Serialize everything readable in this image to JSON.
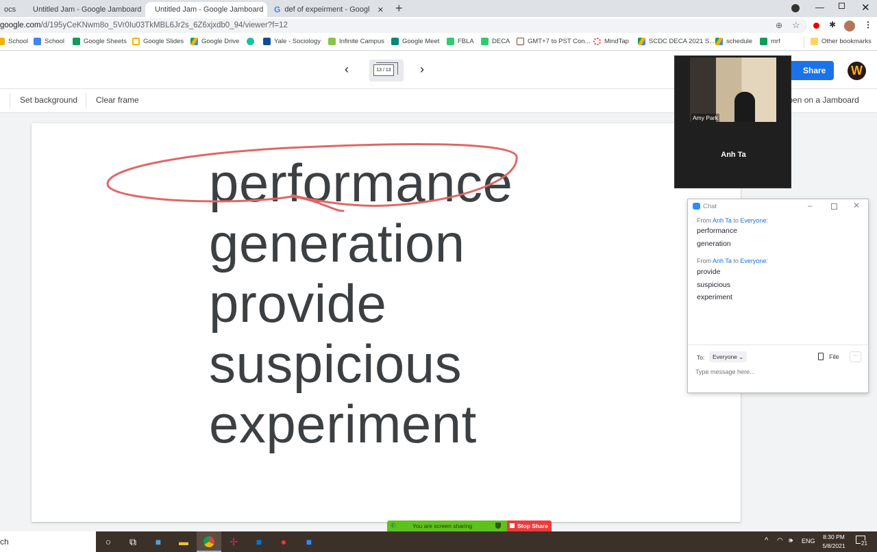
{
  "browser": {
    "tabs": [
      {
        "label": "ocs",
        "icon": "docs-icon"
      },
      {
        "label": "Untitled Jam - Google Jamboard",
        "icon": "jamboard-icon"
      },
      {
        "label": "Untitled Jam - Google Jamboard",
        "icon": "jamboard-icon",
        "active": true
      },
      {
        "label": "def of expeirment - Google Searc",
        "icon": "google-icon"
      }
    ],
    "new_tab": "+",
    "url_host": "google.com",
    "url_path": "/d/195yCeKNwm8o_5Vr0Iu03TkMBL6Jr2s_6Z6xjxdb0_94/viewer?f=12",
    "bookmarks": [
      {
        "label": "School",
        "color": "#f4b400"
      },
      {
        "label": "School",
        "color": "#4285f4"
      },
      {
        "label": "Google Sheets",
        "color": "#0f9d58"
      },
      {
        "label": "Google Slides",
        "color": "#f4b400"
      },
      {
        "label": "Google Drive",
        "color": "#1a73e8"
      },
      {
        "label": "",
        "color": "#15c39a"
      },
      {
        "label": "Yale - Sociology",
        "color": "#0f4d92"
      },
      {
        "label": "Infinite Campus",
        "color": "#8bc34a"
      },
      {
        "label": "Google Meet",
        "color": "#00897b"
      },
      {
        "label": "FBLA",
        "color": "#2ecc71"
      },
      {
        "label": "DECA",
        "color": "#2ecc71"
      },
      {
        "label": "GMT+7 to PST Con...",
        "color": "#8d3b2f"
      },
      {
        "label": "MindTap",
        "color": "#e53935"
      },
      {
        "label": "SCDC DECA 2021 S...",
        "color": "#1a73e8"
      },
      {
        "label": "schedule",
        "color": "#1a73e8"
      },
      {
        "label": "mrf",
        "color": "#0f9d58"
      }
    ],
    "other_bookmarks": "Other bookmarks"
  },
  "jamboard": {
    "frame_counter": "13 / 13",
    "share_label": "Share",
    "set_background": "Set background",
    "clear_frame": "Clear frame",
    "open_on_jamboard": "Open on a Jamboard",
    "words": [
      "performance",
      "generation",
      "provide",
      "suspicious",
      "experiment"
    ],
    "annotation_color": "#e06666"
  },
  "zoom": {
    "video_name": "Amy Park",
    "participant": "Anh Ta",
    "chat": {
      "title": "Chat",
      "messages": [
        {
          "from": "Anh Ta",
          "to": "Everyone",
          "lines": [
            "performance",
            "generation"
          ]
        },
        {
          "from": "Anh Ta",
          "to": "Everyone",
          "lines": [
            "provide",
            "suspicious",
            "experiment"
          ]
        }
      ],
      "from_label": "From",
      "to_word": "to",
      "to_label": "To:",
      "recipient": "Everyone",
      "file_label": "File",
      "placeholder": "Type message here..."
    },
    "sharing_text": "You are screen sharing",
    "stop_share": "Stop Share"
  },
  "taskbar": {
    "search": "ch",
    "lang": "ENG",
    "time": "8:30 PM",
    "date": "5/8/2021",
    "notifications": "21"
  }
}
